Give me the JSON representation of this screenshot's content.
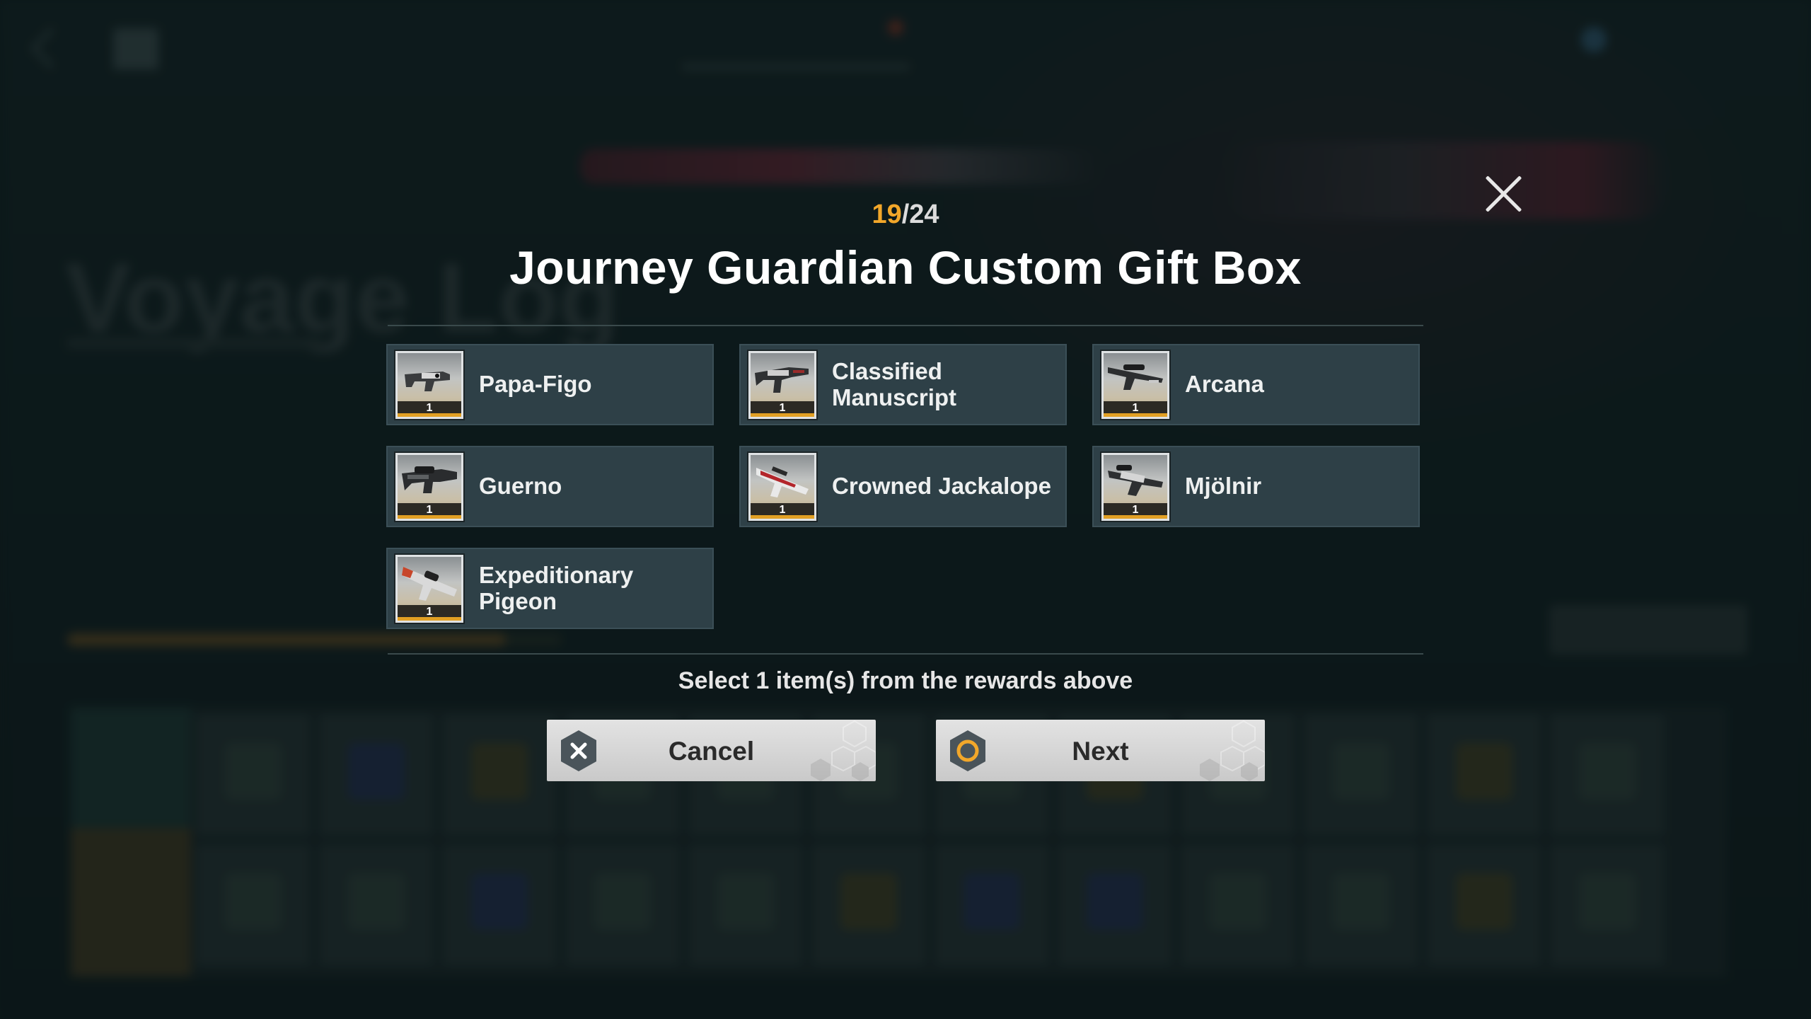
{
  "background": {
    "screen_title": "Voyage Log"
  },
  "modal": {
    "counter": {
      "current": "19",
      "separator": "/",
      "total": "24"
    },
    "title": "Journey Guardian Custom Gift Box",
    "items": [
      {
        "name": "Papa-Figo",
        "qty": "1",
        "icon": "smg-icon"
      },
      {
        "name": "Classified Manuscript",
        "qty": "1",
        "icon": "assault-rifle-icon"
      },
      {
        "name": "Arcana",
        "qty": "1",
        "icon": "sniper-rifle-icon"
      },
      {
        "name": "Guerno",
        "qty": "1",
        "icon": "heavy-rifle-icon"
      },
      {
        "name": "Crowned Jackalope",
        "qty": "1",
        "icon": "red-rifle-icon"
      },
      {
        "name": "Mjölnir",
        "qty": "1",
        "icon": "machine-gun-icon"
      },
      {
        "name": "Expeditionary Pigeon",
        "qty": "1",
        "icon": "launcher-icon"
      }
    ],
    "hint": "Select 1 item(s) from the rewards above",
    "buttons": {
      "cancel": {
        "label": "Cancel",
        "icon": "cross-hex-icon"
      },
      "next": {
        "label": "Next",
        "icon": "circle-hex-icon"
      }
    }
  },
  "colors": {
    "accent_gold": "#f2a72a",
    "item_bg": "#2e4047",
    "button_bg": "#d9d9d9"
  }
}
